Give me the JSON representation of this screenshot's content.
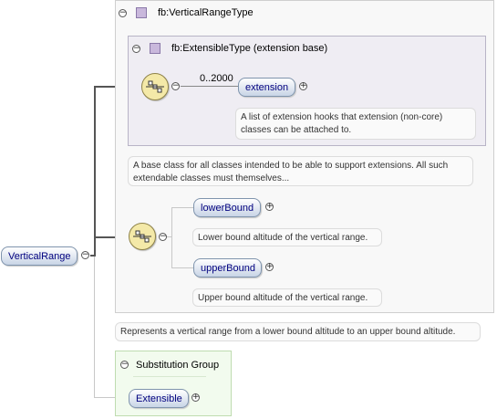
{
  "outer_type": {
    "title": "fb:VerticalRangeType"
  },
  "inner_type": {
    "title": "fb:ExtensibleType (extension base)"
  },
  "extension_seq": {
    "cardinality": "0..2000"
  },
  "extension": {
    "label": "extension",
    "doc": "A list of extension hooks that extension (non-core) classes can be attached to."
  },
  "inner_doc": "A base class for all classes intended to be able to support extensions. All such extendable classes must themselves...",
  "lower_bound": {
    "label": "lowerBound",
    "doc": "Lower bound altitude of the vertical range."
  },
  "upper_bound": {
    "label": "upperBound",
    "doc": "Upper bound altitude of the vertical range."
  },
  "outer_doc": "Represents a vertical range from a lower bound altitude to an upper bound altitude.",
  "root": {
    "label": "VerticalRange"
  },
  "substitution": {
    "title": "Substitution Group",
    "member": "Extensible"
  },
  "icons": {
    "collapse": "−",
    "expand": "+"
  },
  "colors": {
    "element_text": "#00007f",
    "sequence_fill": "#f4e9a8",
    "type_fill": "#c9b8dc",
    "substitution_fill": "#f2fbee"
  }
}
